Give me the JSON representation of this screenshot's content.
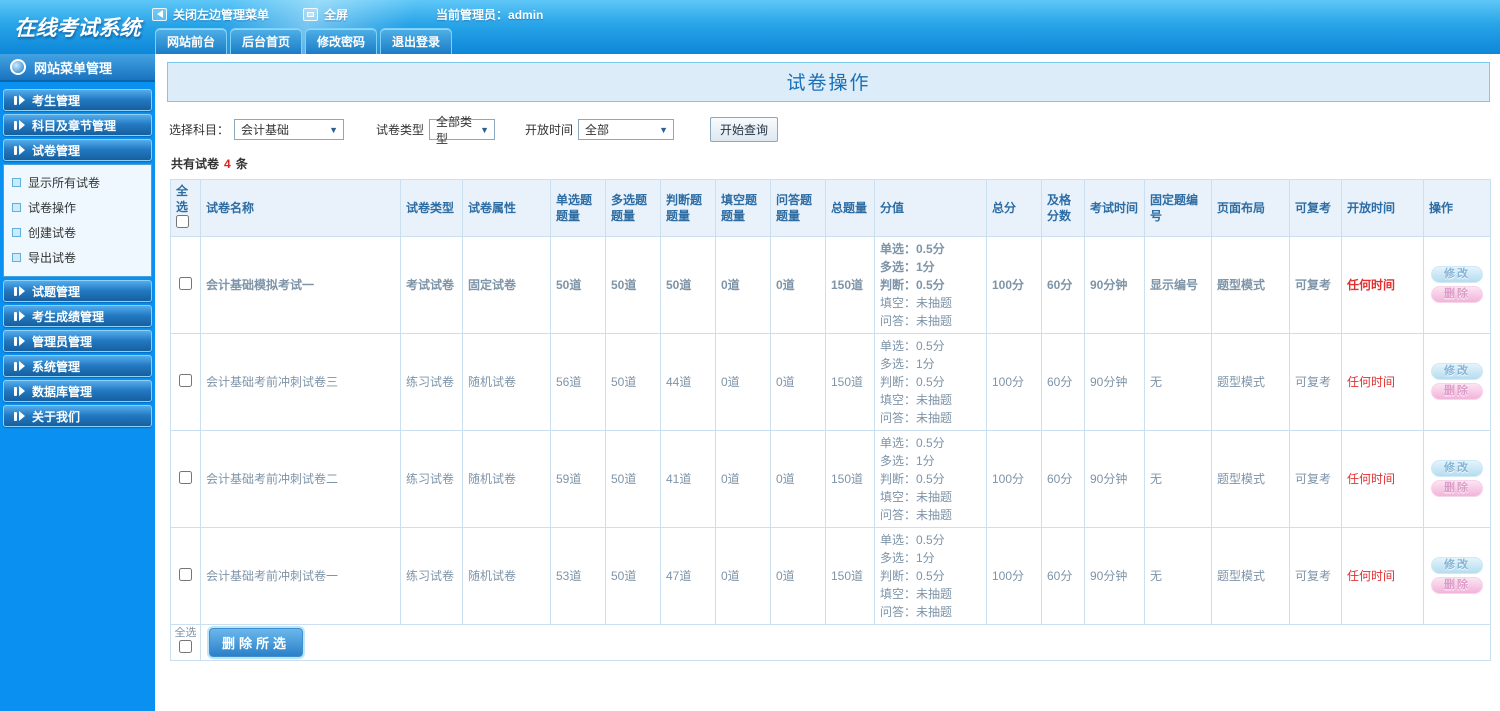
{
  "app": {
    "logo": "在线考试系统"
  },
  "topbar": {
    "close_menu": "关闭左边管理菜单",
    "fullscreen": "全屏",
    "admin_label": "当前管理员：admin",
    "tabs": [
      "网站前台",
      "后台首页",
      "修改密码",
      "退出登录"
    ]
  },
  "sidebar": {
    "title": "网站菜单管理",
    "menu": [
      {
        "label": "考生管理"
      },
      {
        "label": "科目及章节管理"
      },
      {
        "label": "试卷管理",
        "submenu": [
          "显示所有试卷",
          "试卷操作",
          "创建试卷",
          "导出试卷"
        ]
      },
      {
        "label": "试题管理"
      },
      {
        "label": "考生成绩管理"
      },
      {
        "label": "管理员管理"
      },
      {
        "label": "系统管理"
      },
      {
        "label": "数据库管理"
      },
      {
        "label": "关于我们"
      }
    ]
  },
  "main": {
    "page_title": "试卷操作",
    "filters": [
      {
        "label": "选择科目：",
        "value": "会计基础"
      },
      {
        "label": "试卷类型",
        "value": "全部类型"
      },
      {
        "label": "开放时间",
        "value": "全部"
      }
    ],
    "query_button": "开始查询",
    "count_prefix": "共有试卷",
    "count_number": "4",
    "count_suffix": "条"
  },
  "table": {
    "headers": [
      "全选",
      "试卷名称",
      "试卷类型",
      "试卷属性",
      "单选题题量",
      "多选题题量",
      "判断题题量",
      "填空题题量",
      "问答题题量",
      "总题量",
      "分值",
      "总分",
      "及格分数",
      "考试时间",
      "固定题编号",
      "页面布局",
      "可复考",
      "开放时间",
      "操作"
    ],
    "rows": [
      {
        "name": "会计基础模拟考试一",
        "type": "考试试卷",
        "attr": "固定试卷",
        "single": "50道",
        "multi": "50道",
        "judge": "50道",
        "blank": "0道",
        "qa": "0道",
        "total": "150道",
        "score_lines": [
          "单选：0.5分",
          "多选：1分",
          "判断：0.5分",
          "填空：未抽题",
          "问答：未抽题"
        ],
        "total_score": "100分",
        "pass_score": "60分",
        "exam_time": "90分钟",
        "fixed_no": "显示编号",
        "layout": "题型模式",
        "retake": "可复考",
        "open_time": "任何时间",
        "bold": true
      },
      {
        "name": "会计基础考前冲刺试卷三",
        "type": "练习试卷",
        "attr": "随机试卷",
        "single": "56道",
        "multi": "50道",
        "judge": "44道",
        "blank": "0道",
        "qa": "0道",
        "total": "150道",
        "score_lines": [
          "单选：0.5分",
          "多选：1分",
          "判断：0.5分",
          "填空：未抽题",
          "问答：未抽题"
        ],
        "total_score": "100分",
        "pass_score": "60分",
        "exam_time": "90分钟",
        "fixed_no": "无",
        "layout": "题型模式",
        "retake": "可复考",
        "open_time": "任何时间",
        "bold": false
      },
      {
        "name": "会计基础考前冲刺试卷二",
        "type": "练习试卷",
        "attr": "随机试卷",
        "single": "59道",
        "multi": "50道",
        "judge": "41道",
        "blank": "0道",
        "qa": "0道",
        "total": "150道",
        "score_lines": [
          "单选：0.5分",
          "多选：1分",
          "判断：0.5分",
          "填空：未抽题",
          "问答：未抽题"
        ],
        "total_score": "100分",
        "pass_score": "60分",
        "exam_time": "90分钟",
        "fixed_no": "无",
        "layout": "题型模式",
        "retake": "可复考",
        "open_time": "任何时间",
        "bold": false
      },
      {
        "name": "会计基础考前冲刺试卷一",
        "type": "练习试卷",
        "attr": "随机试卷",
        "single": "53道",
        "multi": "50道",
        "judge": "47道",
        "blank": "0道",
        "qa": "0道",
        "total": "150道",
        "score_lines": [
          "单选：0.5分",
          "多选：1分",
          "判断：0.5分",
          "填空：未抽题",
          "问答：未抽题"
        ],
        "total_score": "100分",
        "pass_score": "60分",
        "exam_time": "90分钟",
        "fixed_no": "无",
        "layout": "题型模式",
        "retake": "可复考",
        "open_time": "任何时间",
        "bold": false
      }
    ],
    "actions": {
      "edit": "修改",
      "delete": "删除"
    },
    "footer": {
      "select_all": "全选",
      "delete_selected": "删除所选"
    }
  },
  "colors": {
    "accent_blue": "#0a90f0",
    "title_blue": "#1a70b8",
    "open_time_red": "#e03030",
    "count_red": "#e02020",
    "edit_pill": "#b5dcf0",
    "delete_pill": "#f2b3da"
  }
}
